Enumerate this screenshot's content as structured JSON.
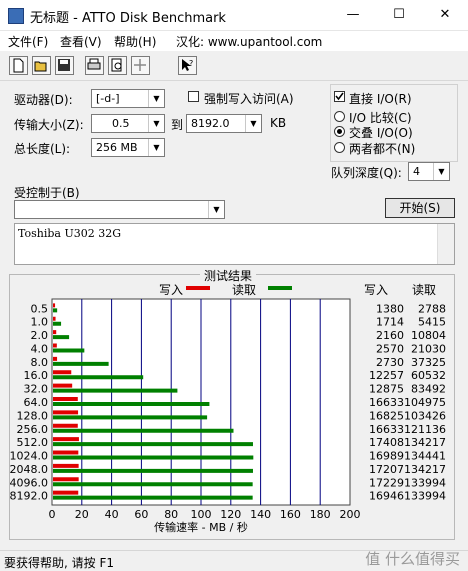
{
  "window": {
    "title": "无标题 - ATTO Disk Benchmark",
    "minimize": "—",
    "maximize": "☐",
    "close": "✕"
  },
  "menu": {
    "file": "文件(F)",
    "view": "查看(V)",
    "help": "帮助(H)",
    "credit": "汉化: www.upantool.com"
  },
  "toolbar": {
    "icons": [
      "new-icon",
      "open-icon",
      "save-icon",
      "print-icon",
      "preview-icon",
      "move-icon",
      "help-pointer-icon"
    ]
  },
  "form": {
    "drive_label": "驱动器(D):",
    "drive_value": "[-d-]",
    "force_write_label": "强制写入访问(A)",
    "transfer_label": "传输大小(Z):",
    "transfer_from": "0.5",
    "transfer_to_label": "到",
    "transfer_to": "8192.0",
    "transfer_unit": "KB",
    "length_label": "总长度(L):",
    "length_value": "256 MB",
    "direct_io_label": "直接 I/O(R)",
    "io_compare_label": "I/O 比较(C)",
    "overlapped_io_label": "交叠 I/O(O)",
    "neither_label": "两者都不(N)",
    "queue_label": "队列深度(Q):",
    "queue_value": "4",
    "controlled_by_label": "受控制于(B)",
    "controlled_by_value": "",
    "start_button": "开始(S)",
    "description": "Toshiba  U302 32G"
  },
  "results": {
    "group_title": "测试结果",
    "write_legend": "写入",
    "read_legend": "读取",
    "write_col": "写入",
    "read_col": "读取"
  },
  "chart_data": {
    "type": "bar",
    "orientation": "horizontal",
    "categories": [
      "0.5",
      "1.0",
      "2.0",
      "4.0",
      "8.0",
      "16.0",
      "32.0",
      "64.0",
      "128.0",
      "256.0",
      "512.0",
      "1024.0",
      "2048.0",
      "4096.0",
      "8192.0"
    ],
    "series": [
      {
        "name": "写入",
        "color": "#e00000",
        "values": [
          1380,
          1714,
          2160,
          2570,
          2730,
          12257,
          12875,
          16633,
          16825,
          16633,
          17408,
          16989,
          17207,
          17229,
          16946
        ]
      },
      {
        "name": "读取",
        "color": "#008000",
        "values": [
          2788,
          5415,
          10804,
          21030,
          37325,
          60532,
          83492,
          104975,
          103426,
          121136,
          134217,
          134441,
          134217,
          133994,
          133994
        ]
      }
    ],
    "xlabel": "传输速率 - MB / 秒",
    "xlim": [
      0,
      200
    ],
    "xticks": [
      "0",
      "20",
      "40",
      "60",
      "80",
      "100",
      "120",
      "140",
      "160",
      "180",
      "200"
    ],
    "value_unit_divisor": 1000
  },
  "status": {
    "text": "要获得帮助, 请按 F1",
    "watermark": "值 什么值得买"
  },
  "colors": {
    "write": "#e00000",
    "read": "#008000",
    "gridline": "#000080"
  }
}
